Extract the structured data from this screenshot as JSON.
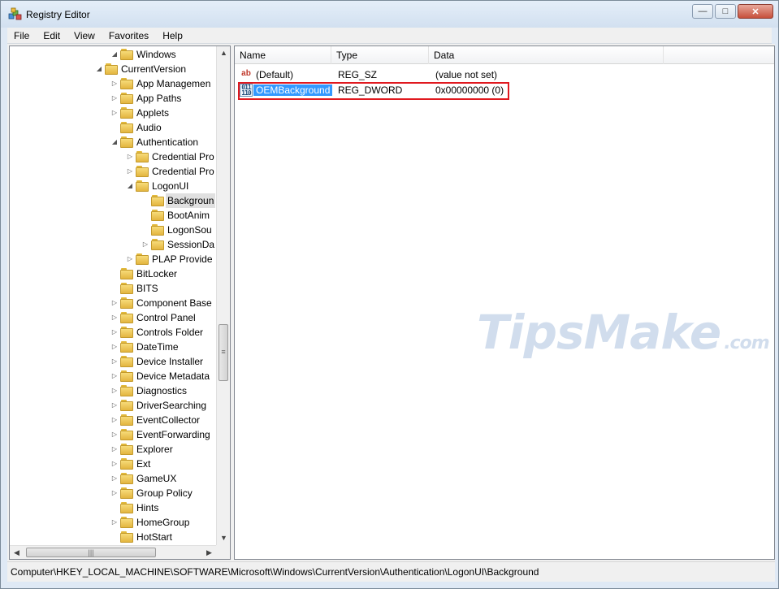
{
  "window": {
    "title": "Registry Editor",
    "minimize": "—",
    "maximize": "□",
    "close": "✕"
  },
  "menu": [
    "File",
    "Edit",
    "View",
    "Favorites",
    "Help"
  ],
  "tree": {
    "selected": "Background",
    "items": [
      {
        "label": "Windows",
        "expander": "expanded"
      },
      {
        "label": "CurrentVersion",
        "expander": "expanded"
      },
      {
        "label": "App Managemen",
        "expander": "collapsed"
      },
      {
        "label": "App Paths",
        "expander": "collapsed"
      },
      {
        "label": "Applets",
        "expander": "collapsed"
      },
      {
        "label": "Audio",
        "expander": "none"
      },
      {
        "label": "Authentication",
        "expander": "expanded"
      },
      {
        "label": "Credential Pro",
        "expander": "collapsed"
      },
      {
        "label": "Credential Pro",
        "expander": "collapsed"
      },
      {
        "label": "LogonUI",
        "expander": "expanded"
      },
      {
        "label": "Backgroun",
        "expander": "none"
      },
      {
        "label": "BootAnim",
        "expander": "none"
      },
      {
        "label": "LogonSou",
        "expander": "none"
      },
      {
        "label": "SessionDa",
        "expander": "collapsed"
      },
      {
        "label": "PLAP Provide",
        "expander": "collapsed"
      },
      {
        "label": "BitLocker",
        "expander": "none"
      },
      {
        "label": "BITS",
        "expander": "none"
      },
      {
        "label": "Component Base",
        "expander": "collapsed"
      },
      {
        "label": "Control Panel",
        "expander": "collapsed"
      },
      {
        "label": "Controls Folder",
        "expander": "collapsed"
      },
      {
        "label": "DateTime",
        "expander": "collapsed"
      },
      {
        "label": "Device Installer",
        "expander": "collapsed"
      },
      {
        "label": "Device Metadata",
        "expander": "collapsed"
      },
      {
        "label": "Diagnostics",
        "expander": "collapsed"
      },
      {
        "label": "DriverSearching",
        "expander": "collapsed"
      },
      {
        "label": "EventCollector",
        "expander": "collapsed"
      },
      {
        "label": "EventForwarding",
        "expander": "collapsed"
      },
      {
        "label": "Explorer",
        "expander": "collapsed"
      },
      {
        "label": "Ext",
        "expander": "collapsed"
      },
      {
        "label": "GameUX",
        "expander": "collapsed"
      },
      {
        "label": "Group Policy",
        "expander": "collapsed"
      },
      {
        "label": "Hints",
        "expander": "none"
      },
      {
        "label": "HomeGroup",
        "expander": "collapsed"
      },
      {
        "label": "HotStart",
        "expander": "none"
      }
    ]
  },
  "list": {
    "columns": [
      "Name",
      "Type",
      "Data"
    ],
    "rows": [
      {
        "name": "(Default)",
        "type": "REG_SZ",
        "data": "(value not set)",
        "icon": "string-value-icon"
      },
      {
        "name": "OEMBackground",
        "type": "REG_DWORD",
        "data": "0x00000000 (0)",
        "icon": "dword-value-icon"
      }
    ]
  },
  "watermark": {
    "brand": "TipsMake",
    "suffix": ".com"
  },
  "statusbar": "Computer\\HKEY_LOCAL_MACHINE\\SOFTWARE\\Microsoft\\Windows\\CurrentVersion\\Authentication\\LogonUI\\Background",
  "icons": {
    "app": "registry-editor-icon",
    "folder": "folder-icon"
  },
  "colors": {
    "selection": "#3399ff",
    "highlight": "#e0191f",
    "folder": "#e3b53f"
  }
}
